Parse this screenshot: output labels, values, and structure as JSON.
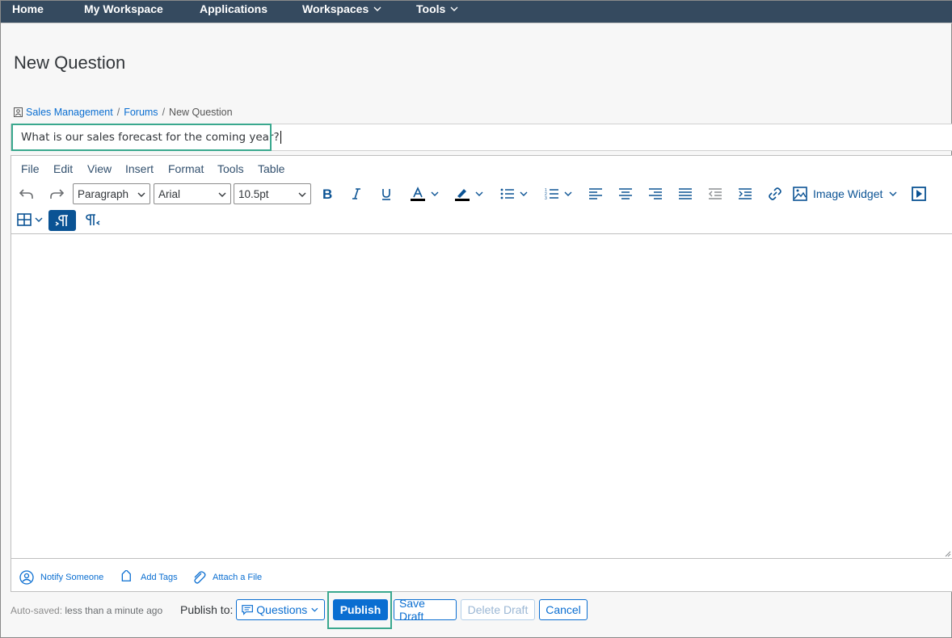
{
  "nav": {
    "items": [
      "Home",
      "My Workspace",
      "Applications",
      "Workspaces",
      "Tools"
    ]
  },
  "page": {
    "title": "New Question"
  },
  "breadcrumb": {
    "items": [
      "Sales Management",
      "Forums"
    ],
    "current": "New Question",
    "separator": "/"
  },
  "question": {
    "title_value": "What is our sales forecast for the coming year?"
  },
  "editor": {
    "menu": [
      "File",
      "Edit",
      "View",
      "Insert",
      "Format",
      "Tools",
      "Table"
    ],
    "block_format": "Paragraph",
    "font_family": "Arial",
    "font_size": "10.5pt",
    "image_widget_label": "Image Widget"
  },
  "footer_actions": {
    "notify": "Notify Someone",
    "tags": "Add Tags",
    "attach": "Attach a File"
  },
  "bottom": {
    "autosaved_label": "Auto-saved:",
    "autosaved_value": "less than a minute ago",
    "publish_to_label": "Publish to:",
    "publish_to_value": "Questions",
    "publish_button": "Publish",
    "save_draft_button": "Save Draft",
    "delete_draft_button": "Delete Draft",
    "cancel_button": "Cancel"
  },
  "colors": {
    "nav_bg": "#354a5f",
    "accent": "#0a6ed1",
    "highlight": "#3aa88e"
  }
}
